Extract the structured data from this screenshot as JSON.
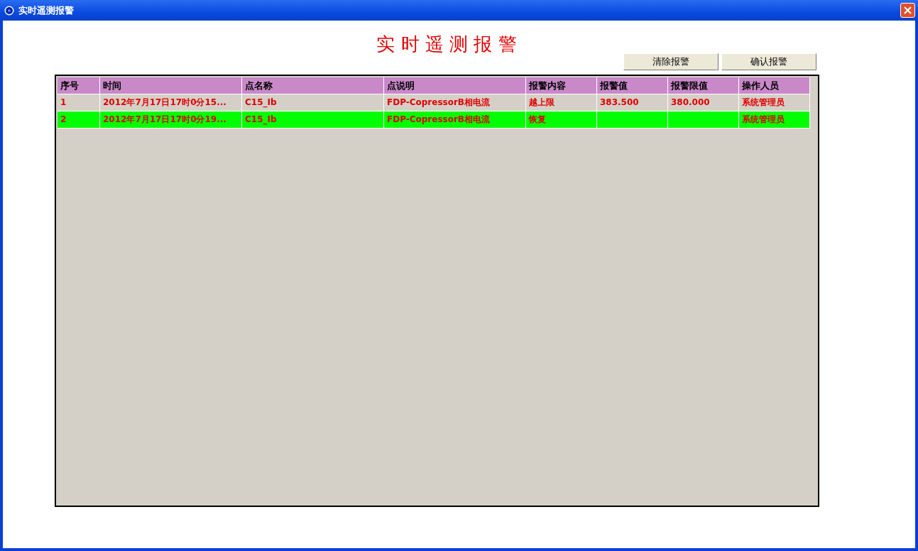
{
  "window": {
    "title": "实时遥测报警"
  },
  "heading": "实 时 遥 测 报 警",
  "buttons": [
    "清除报警",
    "确认报警"
  ],
  "table": {
    "columns": [
      "序号",
      "时间",
      "点名称",
      "点说明",
      "报警内容",
      "报警值",
      "报警限值",
      "操作人员"
    ],
    "rows": [
      {
        "color": "#d4d0c8",
        "cells": [
          "1",
          "2012年7月17日17时0分15...",
          "C15_Ib",
          "FDP-CopressorB相电流",
          "越上限",
          "383.500",
          "380.000",
          "系统管理员"
        ]
      },
      {
        "color": "#00ff00",
        "cells": [
          "2",
          "2012年7月17日17时0分19...",
          "C15_Ib",
          "FDP-CopressorB相电流",
          "恢复",
          null,
          null,
          "系统管理员"
        ]
      }
    ]
  }
}
